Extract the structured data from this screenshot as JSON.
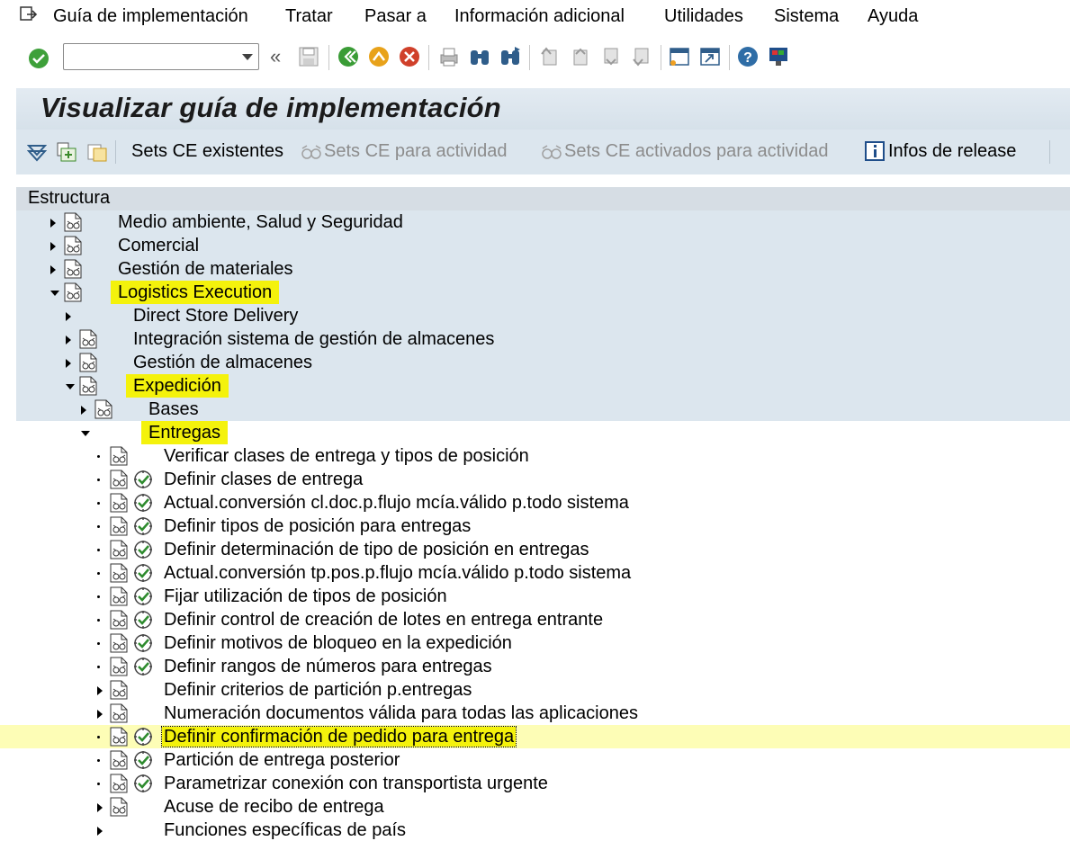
{
  "menu": {
    "items": [
      {
        "label": "Guía de implementación"
      },
      {
        "label": "Tratar"
      },
      {
        "label": "Pasar a"
      },
      {
        "label": "Información adicional"
      },
      {
        "label": "Utilidades"
      },
      {
        "label": "Sistema"
      },
      {
        "label": "Ayuda"
      }
    ]
  },
  "toolbar": {
    "command_value": "",
    "back_glyph": "«"
  },
  "title": "Visualizar guía de implementación",
  "app_toolbar": {
    "sets_existing": "Sets CE existentes",
    "sets_activity": "Sets CE para actividad",
    "sets_activated": "Sets CE activados para actividad",
    "release_info": "Infos de release"
  },
  "tree": {
    "header": "Estructura",
    "rows": [
      {
        "label": "Medio ambiente, Salud y Seguridad"
      },
      {
        "label": "Comercial"
      },
      {
        "label": "Gestión de materiales"
      },
      {
        "label": "Logistics Execution"
      },
      {
        "label": "Direct Store Delivery"
      },
      {
        "label": "Integración sistema de gestión de almacenes"
      },
      {
        "label": "Gestión de almacenes"
      },
      {
        "label": "Expedición"
      },
      {
        "label": "Bases"
      },
      {
        "label": "Entregas"
      },
      {
        "label": "Verificar clases de entrega y tipos de posición"
      },
      {
        "label": "Definir clases de entrega"
      },
      {
        "label": "Actual.conversión cl.doc.p.flujo mcía.válido p.todo sistema"
      },
      {
        "label": "Definir tipos de posición para entregas"
      },
      {
        "label": "Definir determinación de tipo de posición en entregas"
      },
      {
        "label": "Actual.conversión tp.pos.p.flujo mcía.válido p.todo sistema"
      },
      {
        "label": "Fijar utilización de tipos de posición"
      },
      {
        "label": "Definir control de creación de lotes en entrega entrante"
      },
      {
        "label": "Definir motivos de bloqueo en la expedición"
      },
      {
        "label": "Definir rangos de números para entregas"
      },
      {
        "label": "Definir criterios de partición p.entregas"
      },
      {
        "label": "Numeración documentos válida para todas las aplicaciones"
      },
      {
        "label": "Definir confirmación de pedido para entrega"
      },
      {
        "label": "Partición de entrega posterior"
      },
      {
        "label": "Parametrizar conexión con transportista urgente"
      },
      {
        "label": "Acuse de recibo de entrega"
      },
      {
        "label": "Funciones específicas de país"
      }
    ]
  },
  "colors": {
    "highlight": "#f4f20c",
    "selected_row": "#fdfdb6",
    "band": "#dce6ee",
    "title_bg": "#d6e1ea"
  }
}
